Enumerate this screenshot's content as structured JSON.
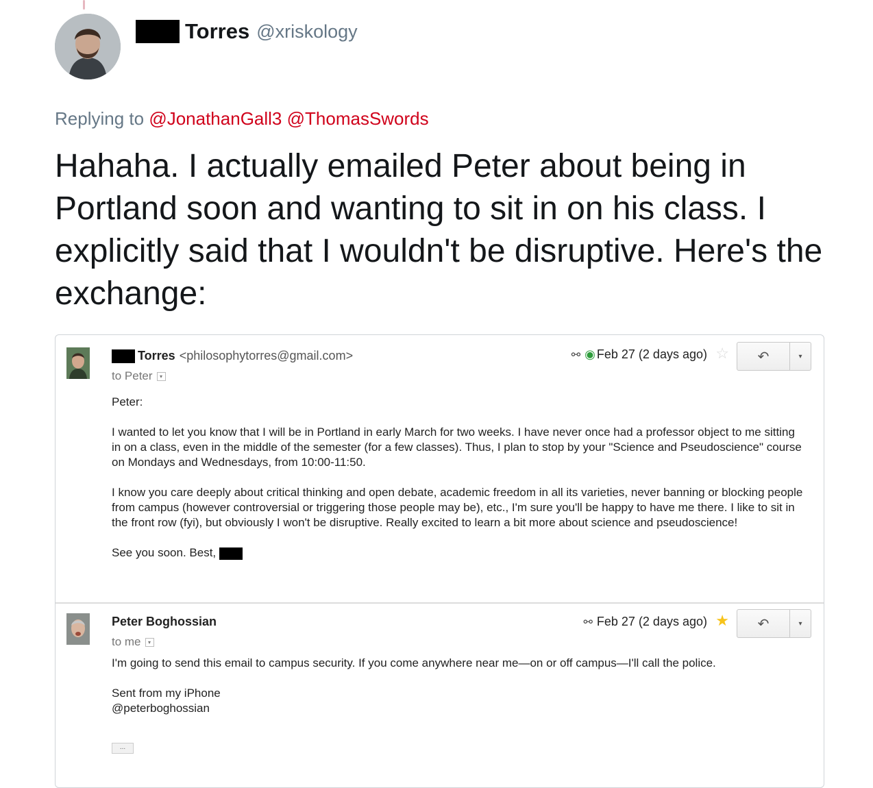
{
  "tweet": {
    "display_name": "Torres",
    "handle": "@xriskology",
    "replying_prefix": "Replying to",
    "mentions": [
      "@JonathanGall3",
      "@ThomasSwords"
    ],
    "text": "Hahaha. I actually emailed Peter about being in Portland soon and wanting to sit in on his class. I explicitly said that I wouldn't be disruptive. Here's the exchange:"
  },
  "email1": {
    "sender_name": "Torres",
    "sender_email": "<philosophytorres@gmail.com>",
    "to": "to Peter",
    "date": "Feb 27 (2 days ago)",
    "greeting": "Peter:",
    "para1": "I wanted to let you know that I will be in Portland in early March for two weeks. I have never once had a professor object to me sitting in on a class, even in the middle of the semester (for a few classes). Thus, I plan to stop by your \"Science and Pseudoscience\" course on Mondays and Wednesdays, from 10:00-11:50.",
    "para2": "I know you care deeply about critical thinking and open debate, academic freedom in all its varieties, never banning or blocking people from campus (however controversial or triggering those people may be), etc., I'm sure you'll be happy to have me there. I like to sit in the front row (fyi), but obviously I won't be disruptive. Really excited to learn a bit more about science and pseudoscience!",
    "closing": "See you soon. Best,"
  },
  "email2": {
    "sender_name": "Peter Boghossian",
    "to": "to me",
    "date": "Feb 27 (2 days ago)",
    "para1": "I'm going to send this email to campus security. If you come anywhere near me—on or off campus—I'll call the police.",
    "sig1": "Sent from my iPhone",
    "sig2": "@peterboghossian",
    "ellipsis": "..."
  },
  "icons": {
    "eye_hidden": "⚯",
    "eye_open": "◉",
    "star_empty": "☆",
    "star_filled": "★",
    "reply": "↶",
    "dropdown": "▾"
  },
  "colors": {
    "mention": "#d0021b",
    "muted": "#657786",
    "star": "#f7c31b",
    "tracked": "#2e9d3c"
  }
}
